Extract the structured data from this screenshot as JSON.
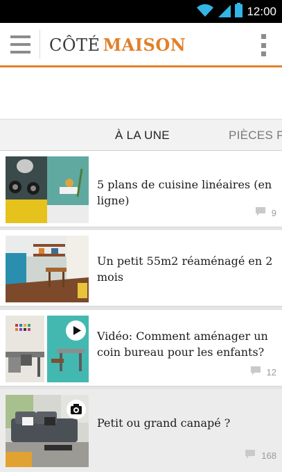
{
  "status_bar": {
    "time": "12:00",
    "icons": [
      "wifi-icon",
      "signal-icon",
      "battery-icon"
    ]
  },
  "app_bar": {
    "logo_part1": "CÔTÉ",
    "logo_part2": "MAISON",
    "accent_color": "#e0802a"
  },
  "tabs": [
    {
      "label": "À LA UNE",
      "active": true
    },
    {
      "label": "PIÈCES PA",
      "active": false
    }
  ],
  "articles": [
    {
      "title": "5 plans de cuisine linéaires (en ligne)",
      "comments": "9",
      "badge": ""
    },
    {
      "title": "Un petit 55m2 réaménagé en 2 mois",
      "comments": "",
      "badge": ""
    },
    {
      "title": "Vidéo: Comment aménager un coin bureau pour les enfants?",
      "comments": "12",
      "badge": "play-icon"
    },
    {
      "title": "Petit ou grand canapé ?",
      "comments": "168",
      "badge": "camera-icon"
    }
  ]
}
